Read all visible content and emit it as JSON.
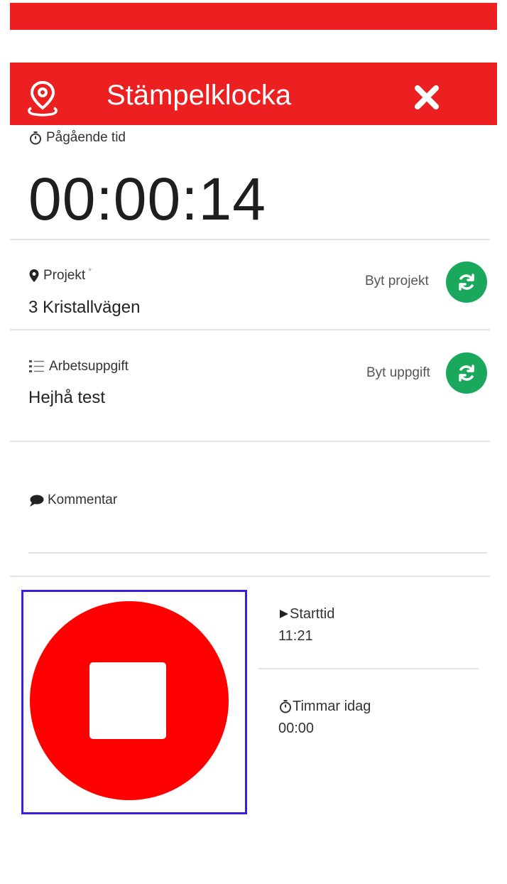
{
  "header": {
    "title": "Stämpelklocka",
    "left_icon": "location-pin-icon",
    "close_icon": "close-icon",
    "color": "#ec2020"
  },
  "timer": {
    "label": "Pågående tid",
    "value": "00:00:14",
    "icon": "stopwatch-icon"
  },
  "project": {
    "label": "Projekt",
    "required_mark": "*",
    "value": "3 Kristallvägen",
    "switch_label": "Byt projekt",
    "icon": "map-marker-icon"
  },
  "task": {
    "label": "Arbetsuppgift",
    "value": "Hejhå test",
    "switch_label": "Byt uppgift",
    "icon": "list-icon"
  },
  "comment": {
    "label": "Kommentar",
    "value": "",
    "icon": "comment-icon"
  },
  "stop_button": {
    "icon": "stop-icon",
    "color": "#ff0000",
    "frame_color": "#3a1ee6"
  },
  "start_time": {
    "label": "Starttid",
    "value": "11:21",
    "icon": "play-icon"
  },
  "hours_today": {
    "label": "Timmar idag",
    "value": "00:00",
    "icon": "stopwatch-icon"
  },
  "accent_green": "#1aa85c"
}
